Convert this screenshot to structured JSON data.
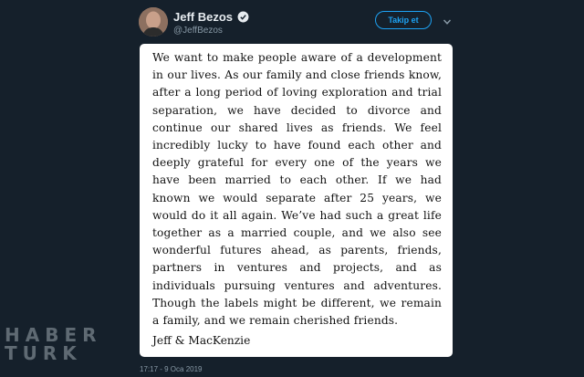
{
  "author": {
    "display_name": "Jeff Bezos",
    "handle": "@JeffBezos",
    "avatar_icon": "profile-photo",
    "verified_icon": "verified-badge-icon"
  },
  "actions": {
    "follow_label": "Takip et",
    "more_icon": "chevron-down-icon"
  },
  "statement": {
    "text": "We want to make people aware of a development in our lives. As our family and close friends know, after a long period of loving exploration and trial separation, we have decided to divorce and continue our shared lives as friends. We feel incredibly lucky to have found each other and deeply grateful for every one of the years we have been married to each other. If we had known we would separate after 25 years, we would do it all again. We’ve had such a great life together as a married couple, and we also see wonderful futures ahead, as parents, friends, partners in ventures and projects, and as individuals pursuing ventures and adventures. Though the labels might be different, we remain a family, and we remain cherished friends.",
    "signature": "Jeff & MacKenzie"
  },
  "timestamp": "17:17 - 9 Oca 2019",
  "watermark": {
    "line1": "HABER",
    "line2": "TURK"
  },
  "colors": {
    "background": "#15202b",
    "accent": "#1da1f2",
    "secondary_text": "#8899a6"
  }
}
